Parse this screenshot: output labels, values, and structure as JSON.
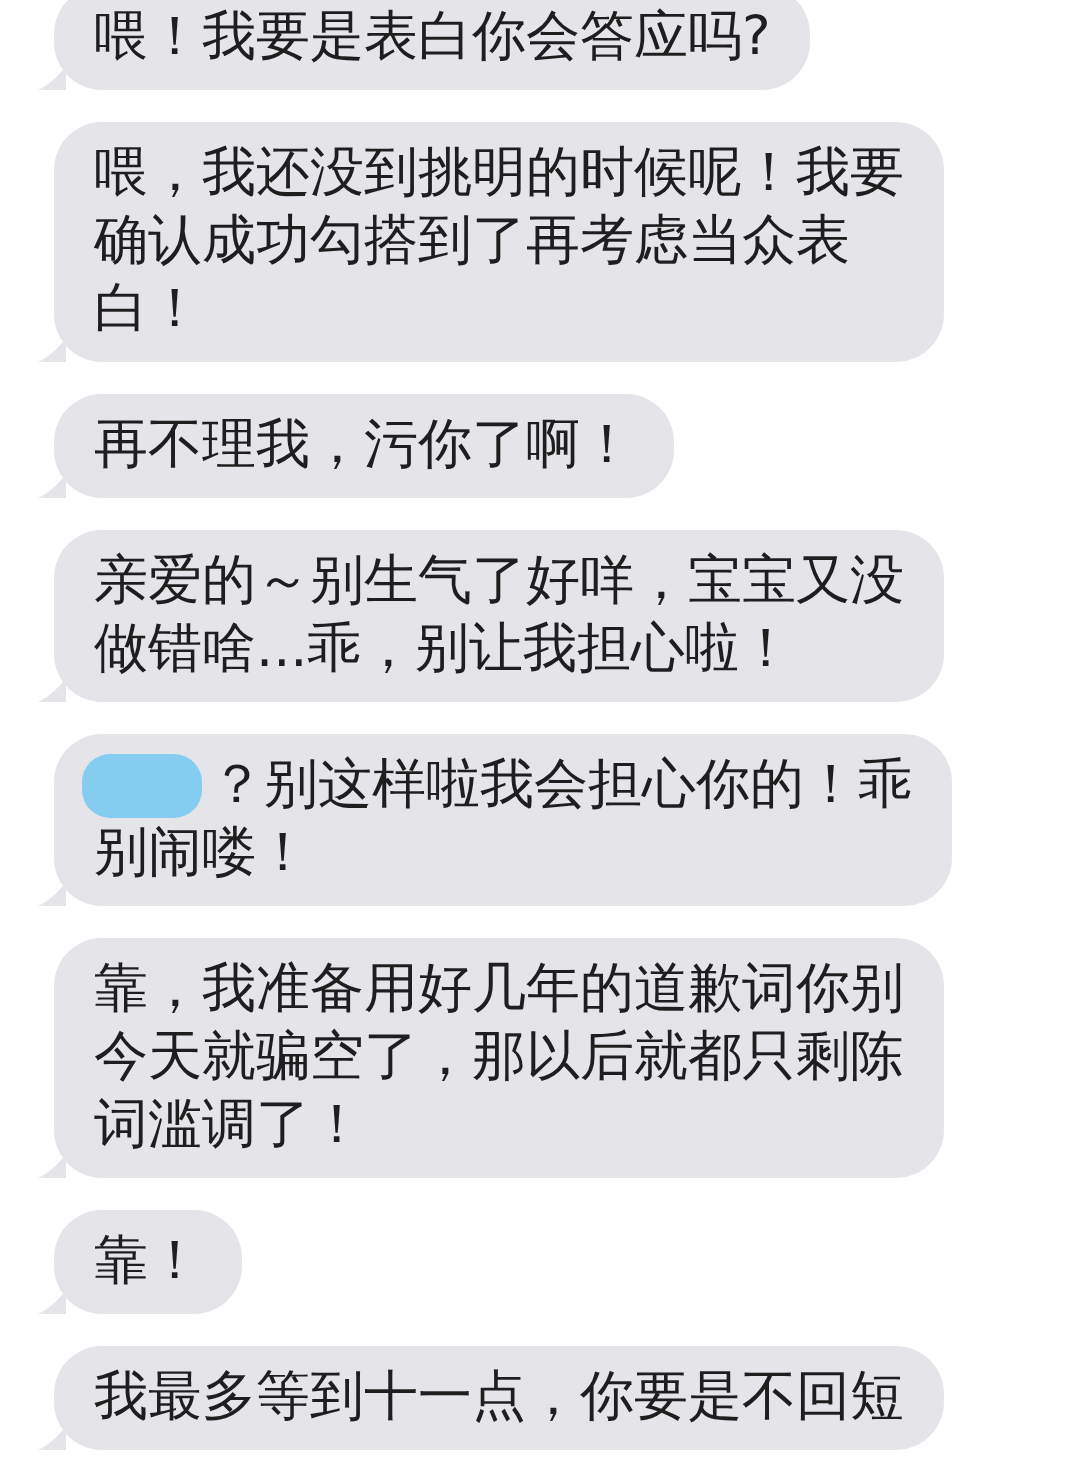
{
  "messages": [
    {
      "lines": [
        "喂！我要是表白你会答应吗?"
      ],
      "redacted_prefix": false
    },
    {
      "lines": [
        "喂，我还没到挑明的时候呢！我要",
        "确认成功勾搭到了再考虑当众表",
        "白！"
      ],
      "redacted_prefix": false
    },
    {
      "lines": [
        "再不理我，污你了啊！"
      ],
      "redacted_prefix": false
    },
    {
      "lines": [
        "亲爱的～别生气了好咩，宝宝又没",
        "做错啥...乖，别让我担心啦！"
      ],
      "redacted_prefix": false
    },
    {
      "lines": [
        "？别这样啦我会担心你的！乖",
        "别闹喽！"
      ],
      "redacted_prefix": true
    },
    {
      "lines": [
        "靠，我准备用好几年的道歉词你别",
        "今天就骗空了，那以后就都只剩陈",
        "词滥调了！"
      ],
      "redacted_prefix": false
    },
    {
      "lines": [
        "靠！"
      ],
      "redacted_prefix": false
    },
    {
      "lines": [
        "我最多等到十一点，你要是不回短"
      ],
      "redacted_prefix": false
    }
  ]
}
